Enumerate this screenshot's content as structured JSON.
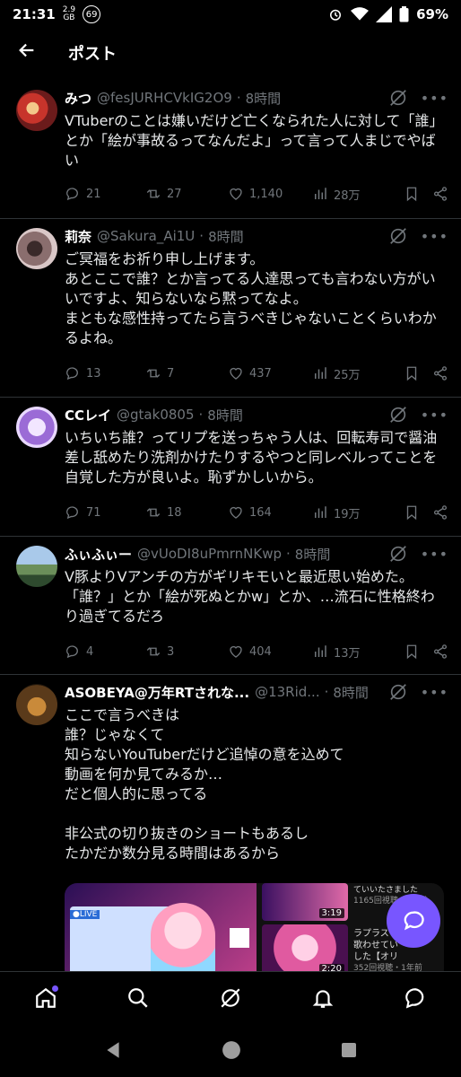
{
  "status": {
    "time": "21:31",
    "data_top": "2.9",
    "data_bottom": "GB",
    "badge": "69",
    "battery": "69%"
  },
  "header": {
    "title": "ポスト"
  },
  "tweets": [
    {
      "name": "みつ",
      "handle": "@fesJURHCVkIG2O9",
      "time": "8時間",
      "text": "VTuberのことは嫌いだけど亡くなられた人に対して「誰」とか「絵が事故るってなんだよ」って言って人まじでやばい",
      "replies": "21",
      "retweets": "27",
      "likes": "1,140",
      "views": "28万"
    },
    {
      "name": "莉奈",
      "handle": "@Sakura_Ai1U",
      "time": "8時間",
      "text": "ご冥福をお祈り申し上げます。\nあとここで誰？とか言ってる人達思っても言わない方がいいですよ、知らないなら黙ってなよ。\nまともな感性持ってたら言うべきじゃないことくらいわかるよね。",
      "replies": "13",
      "retweets": "7",
      "likes": "437",
      "views": "25万"
    },
    {
      "name": "CCレイ",
      "handle": "@gtak0805",
      "time": "8時間",
      "text": "いちいち誰？ってリプを送っちゃう人は、回転寿司で醤油差し舐めたり洗剤かけたりするやつと同レベルってことを自覚した方が良いよ。恥ずかしいから。",
      "replies": "71",
      "retweets": "18",
      "likes": "164",
      "views": "19万"
    },
    {
      "name": "ふぃふぃー",
      "handle": "@vUoDI8uPmrnNKwp",
      "time": "8時間",
      "text": "V豚よりVアンチの方がギリキモいと最近思い始めた。「誰？」とか「絵が死ぬとかw」とか、…流石に性格終わり過ぎてるだろ",
      "replies": "4",
      "retweets": "3",
      "likes": "404",
      "views": "13万"
    },
    {
      "name": "ASOBEYA@万年RTされな...",
      "handle": "@13Rid...",
      "time": "8時間",
      "text": "ここで言うべきは\n誰？じゃなくて\n知らないYouTuberだけど追悼の意を込めて\n動画を何か見てみるか…\nだと個人的に思ってる\n\n非公式の切り抜きのショートもあるし\nたかだか数分見る時間はあるから",
      "media": {
        "live_label": "●LIVE",
        "dur1": "3:19",
        "dur2": "2:20",
        "side_text1": "ていいたさました",
        "side_meta1": "1165回視聴・1年前",
        "side_text2": "ラプラス",
        "side_text3": "歌わせてい",
        "side_text4": "した【オリ",
        "side_meta2": "352回視聴・1年前"
      }
    }
  ],
  "icons": {
    "reply": "reply-icon",
    "retweet": "retweet-icon",
    "like": "heart-icon",
    "views": "views-icon",
    "bookmark": "bookmark-icon",
    "share": "share-icon",
    "grok": "grok-icon",
    "more": "more-icon"
  },
  "colors": {
    "accent": "#7856ff",
    "muted": "#71767b",
    "text": "#e7e9ea",
    "divider": "#2f3336"
  }
}
